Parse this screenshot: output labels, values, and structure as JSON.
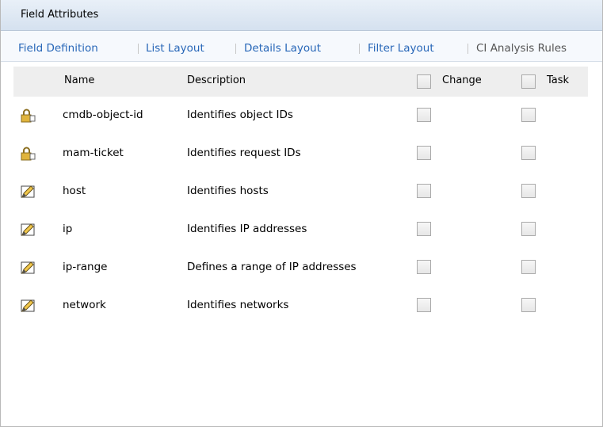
{
  "panel": {
    "title": "Field Attributes"
  },
  "tabs": [
    {
      "label": "Field Definition",
      "active": true
    },
    {
      "label": "List Layout",
      "active": true
    },
    {
      "label": "Details Layout",
      "active": true
    },
    {
      "label": "Filter Layout",
      "active": true
    },
    {
      "label": "CI Analysis Rules",
      "active": false
    }
  ],
  "table": {
    "columns": {
      "name": "Name",
      "description": "Description",
      "change": "Change",
      "task": "Task"
    },
    "rows": [
      {
        "icon": "lock-icon",
        "name": "cmdb-object-id",
        "description": "Identifies object IDs",
        "change": false,
        "task": false
      },
      {
        "icon": "lock-icon",
        "name": "mam-ticket",
        "description": "Identifies request IDs",
        "change": false,
        "task": false
      },
      {
        "icon": "edit-pencil-icon",
        "name": "host",
        "description": "Identifies hosts",
        "change": false,
        "task": false
      },
      {
        "icon": "edit-pencil-icon",
        "name": "ip",
        "description": "Identifies IP addresses",
        "change": false,
        "task": false
      },
      {
        "icon": "edit-pencil-icon",
        "name": "ip-range",
        "description": "Defines a range of IP addresses",
        "change": false,
        "task": false
      },
      {
        "icon": "edit-pencil-icon",
        "name": "network",
        "description": "Identifies networks",
        "change": false,
        "task": false
      }
    ]
  },
  "colors": {
    "link": "#2867b8",
    "title_bg": "#dbe6f2",
    "header_bg": "#eeeeee"
  }
}
